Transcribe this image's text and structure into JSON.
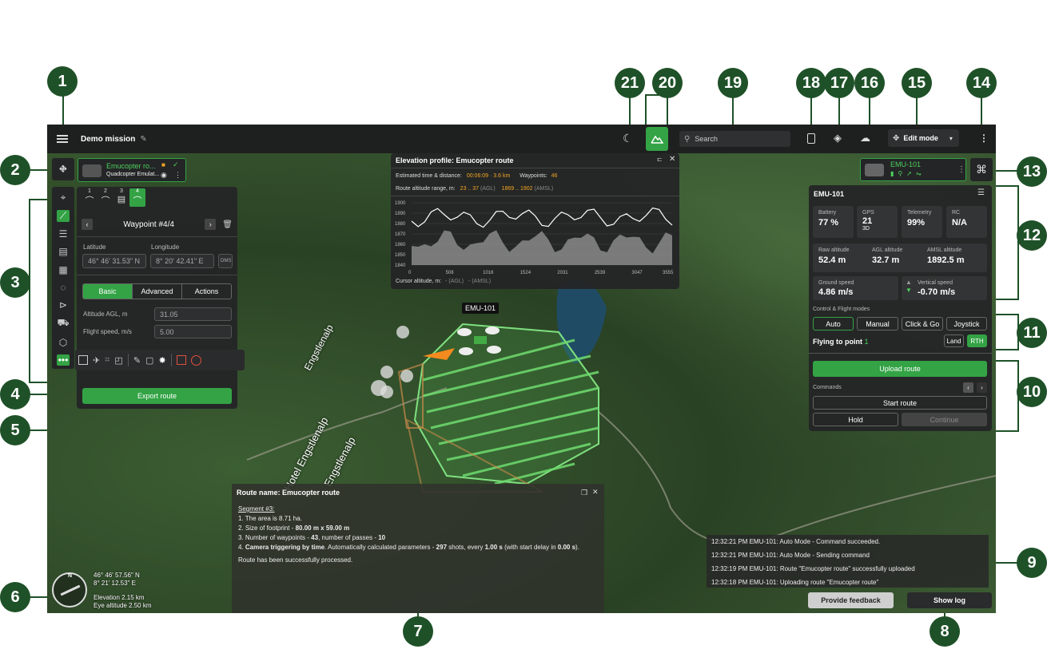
{
  "callouts": [
    "1",
    "2",
    "3",
    "4",
    "5",
    "6",
    "7",
    "8",
    "9",
    "10",
    "11",
    "12",
    "13",
    "14",
    "15",
    "16",
    "17",
    "18",
    "19",
    "20",
    "21"
  ],
  "topbar": {
    "mission_title": "Demo mission",
    "search_placeholder": "Search",
    "edit_mode_label": "Edit mode"
  },
  "drone_card": {
    "name": "Emucopter ro...",
    "type": "Quadcopter Emulat..."
  },
  "waypoint_panel": {
    "tabs": [
      "1",
      "2",
      "3",
      "4"
    ],
    "title": "Waypoint #4/4",
    "latitude_label": "Latitude",
    "longitude_label": "Longitude",
    "latitude": "46° 46' 31.53\" N",
    "longitude": "8° 20' 42.41\" E",
    "dms": "DMS",
    "subtabs": [
      "Basic",
      "Advanced",
      "Actions"
    ],
    "altitude_label": "Altitude AGL, m",
    "altitude_value": "31.05",
    "speed_label": "Flight speed, m/s",
    "speed_value": "5.00",
    "export_label": "Export route"
  },
  "elevation": {
    "title": "Elevation profile: Emucopter route",
    "time_dist_label": "Estimated time & distance:",
    "time_dist_value": "00:06:09 · 3.6 km",
    "waypoints_label": "Waypoints:",
    "waypoints_value": "46",
    "alt_range_label": "Route altitude range, m:",
    "agl_range": "23 .. 37",
    "agl": "(AGL)",
    "amsl_range": "1869 .. 1902",
    "amsl": "(AMSL)",
    "y_ticks": [
      "1900",
      "1890",
      "1880",
      "1870",
      "1860",
      "1850",
      "1840"
    ],
    "x_ticks": [
      "0",
      "508",
      "1016",
      "1524",
      "2031",
      "2539",
      "3047",
      "3555"
    ],
    "cursor_label": "Cursor altitude, m:",
    "cursor_agl": "- (AGL)",
    "cursor_amsl": "- (AMSL)"
  },
  "map": {
    "drone_label": "EMU-101",
    "place_labels": [
      "Hotel Engstlenalp",
      "Engstlenalp",
      "Engstlenalp"
    ],
    "coords_lat": "46° 46' 57.56\" N",
    "coords_lon": "8° 21' 12.53\" E",
    "elevation": "Elevation 2.15 km",
    "eye_altitude": "Eye altitude 2.50 km",
    "compass_n": "N"
  },
  "route_info": {
    "title": "Route name: Emucopter route",
    "segment": "Segment #3:",
    "line1": "1. The area is 8.71 ha.",
    "line2_pre": "2. Size of footprint - ",
    "line2_val": "80.00 m x 59.00 m",
    "line3_pre": "3. Number of waypoints - ",
    "line3_val": "43",
    "line3_mid": ", number of passes - ",
    "line3_val2": "10",
    "line4_pre": "4. ",
    "line4_bold": "Camera triggering by time",
    "line4_mid": ". Automatically calculated parameters - ",
    "line4_shots": "297",
    "line4_mid2": " shots, every ",
    "line4_every": "1.00 s",
    "line4_mid3": " (with start delay in ",
    "line4_delay": "0.00 s",
    "line4_end": ").",
    "processed": "Route has been successfully processed."
  },
  "vehicle_chip": {
    "name": "EMU-101"
  },
  "telemetry": {
    "title": "EMU-101",
    "battery_label": "Battery",
    "battery": "77 %",
    "gps_label": "GPS",
    "gps": "21",
    "gps_fix": "3D",
    "telemetry_label": "Telemetry",
    "telemetry": "99%",
    "rc_label": "RC",
    "rc": "N/A",
    "raw_alt_label": "Raw altitude",
    "raw_alt": "52.4 m",
    "agl_label": "AGL altitude",
    "agl": "32.7 m",
    "amsl_label": "AMSL altitude",
    "amsl": "1892.5 m",
    "gs_label": "Ground speed",
    "gs": "4.86 m/s",
    "vs_label": "Vertical speed",
    "vs": "-0.70 m/s",
    "modes_label": "Control & Flight modes",
    "modes": [
      "Auto",
      "Manual",
      "Click & Go",
      "Joystick"
    ],
    "flying_to": "Flying to point",
    "flying_point": "1",
    "land": "Land",
    "rth": "RTH",
    "upload": "Upload route",
    "commands": "Commands",
    "start": "Start route",
    "hold": "Hold",
    "continue": "Continue"
  },
  "log": [
    "12:32:21 PM  EMU-101: Auto Mode - Command succeeded.",
    "12:32:21 PM  EMU-101: Auto Mode - Sending command",
    "12:32:19 PM  EMU-101: Route \"Emucopter route\" successfully uploaded",
    "12:32:18 PM  EMU-101: Uploading route \"Emucopter route\""
  ],
  "feedback_label": "Provide feedback",
  "show_log_label": "Show log",
  "colors": {
    "accent": "#33a345",
    "callout": "#1f5128",
    "orange": "#f5a623"
  }
}
